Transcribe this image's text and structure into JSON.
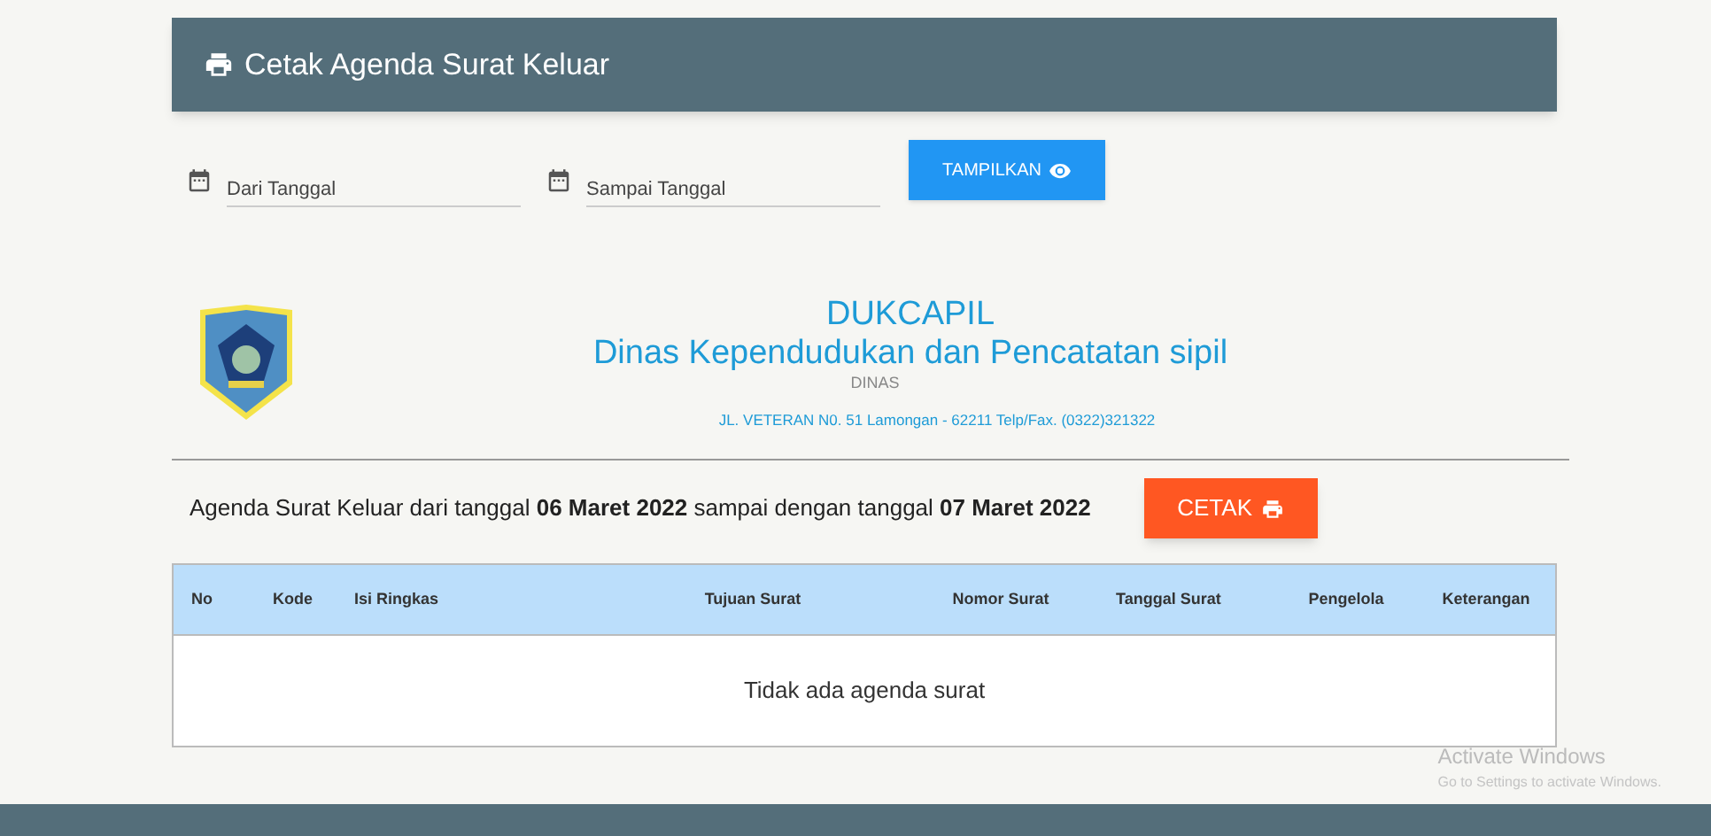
{
  "header": {
    "title": "Cetak Agenda Surat Keluar"
  },
  "filters": [
    {
      "placeholder": "Dari Tanggal"
    },
    {
      "placeholder": "Sampai Tanggal"
    }
  ],
  "show_button": "TAMPILKAN",
  "letterhead": {
    "name": "DUKCAPIL",
    "agency": "Dinas Kependudukan dan Pencatatan sipil",
    "sub": "DINAS",
    "address": "JL. VETERAN N0. 51 Lamongan - 62211 Telp/Fax. (0322)321322"
  },
  "summary": "Agenda Surat Keluar dari tanggal **06 Maret 2022** sampai dengan tanggal **07 Maret 2022**",
  "print_button": "CETAK",
  "table": {
    "columns": [
      "No",
      "Kode",
      "Isi Ringkas",
      "Tujuan Surat",
      "Nomor Surat",
      "Tanggal Surat",
      "Pengelola",
      "Keterangan"
    ],
    "empty": "Tidak ada agenda surat"
  },
  "os_notice": {
    "title": "Activate Windows",
    "text": "Go to Settings to activate Windows."
  }
}
